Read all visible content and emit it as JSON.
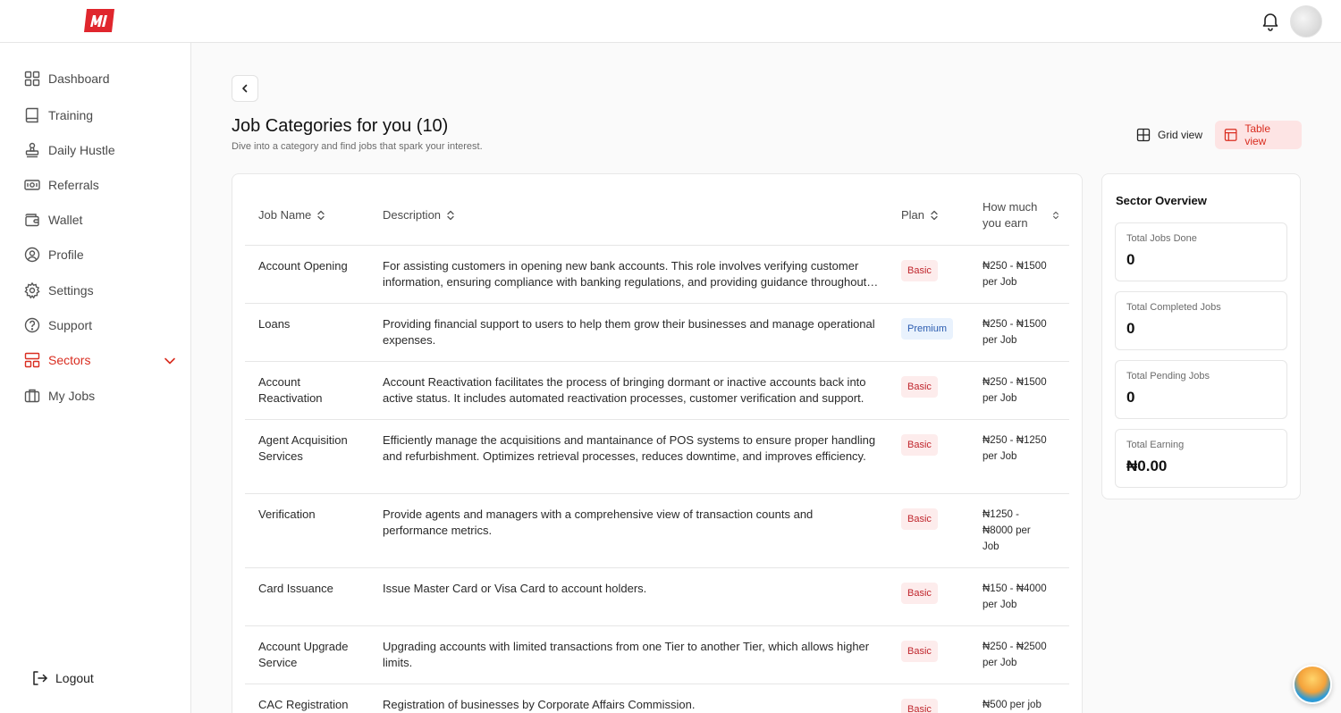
{
  "colors": {
    "accent": "#d92d20",
    "accent_bg": "#fde4e4"
  },
  "sidebar": {
    "items": [
      {
        "label": "Dashboard",
        "icon": "grid-icon"
      },
      {
        "label": "Training",
        "icon": "book-icon"
      },
      {
        "label": "Daily Hustle",
        "icon": "stamp-icon"
      },
      {
        "label": "Referrals",
        "icon": "cash-icon"
      },
      {
        "label": "Wallet",
        "icon": "wallet-icon"
      },
      {
        "label": "Profile",
        "icon": "user-circle-icon"
      },
      {
        "label": "Settings",
        "icon": "gear-icon"
      },
      {
        "label": "Support",
        "icon": "help-circle-icon"
      },
      {
        "label": "Sectors",
        "icon": "layout-icon",
        "active": true
      },
      {
        "label": "My Jobs",
        "icon": "briefcase-icon"
      }
    ],
    "logout_label": "Logout"
  },
  "main": {
    "title": "Job Categories for you (10)",
    "subtitle": "Dive into a category and find jobs that spark your interest.",
    "grid_view_label": "Grid view",
    "table_view_label": "Table view"
  },
  "table": {
    "headers": {
      "name": "Job Name",
      "description": "Description",
      "plan": "Plan",
      "earn": "How much you earn"
    },
    "rows": [
      {
        "name": "Account Opening",
        "description": "For assisting customers in opening new bank accounts. This role involves verifying customer information, ensuring compliance with banking regulations, and providing guidance throughout the process.",
        "plan": "Basic",
        "earn": "₦250 - ₦1500 per Job"
      },
      {
        "name": "Loans",
        "description": "Providing financial support to users to help them grow their businesses and manage operational expenses.",
        "plan": "Premium",
        "earn": "₦250 - ₦1500 per Job"
      },
      {
        "name": "Account Reactivation",
        "description": "Account Reactivation facilitates the process of bringing dormant or inactive accounts back into active status. It includes automated reactivation processes, customer verification and support.",
        "plan": "Basic",
        "earn": "₦250 - ₦1500 per Job"
      },
      {
        "name": "Agent Acquisition Services",
        "description": "Efficiently manage the acquisitions and mantainance of POS systems to ensure proper handling and refurbishment. Optimizes retrieval processes, reduces downtime, and improves efficiency.",
        "plan": "Basic",
        "earn": "₦250 - ₦1250 per Job"
      },
      {
        "name": "Verification",
        "description": "Provide agents and managers with a comprehensive view of transaction counts and performance metrics.",
        "plan": "Basic",
        "earn": "₦1250 - ₦8000 per Job"
      },
      {
        "name": "Card Issuance",
        "description": "Issue Master Card or Visa Card to account holders.",
        "plan": "Basic",
        "earn": "₦150 - ₦4000 per Job"
      },
      {
        "name": "Account Upgrade Service",
        "description": "Upgrading accounts with limited transactions from one Tier to another Tier, which allows higher limits.",
        "plan": "Basic",
        "earn": "₦250 - ₦2500 per Job"
      },
      {
        "name": "CAC Registration",
        "description": "Registration of businesses by Corporate Affairs Commission.",
        "plan": "Basic",
        "earn": "₦500 per job"
      }
    ]
  },
  "overview": {
    "title": "Sector Overview",
    "stats": [
      {
        "label": "Total Jobs Done",
        "value": "0"
      },
      {
        "label": "Total Completed Jobs",
        "value": "0"
      },
      {
        "label": "Total Pending Jobs",
        "value": "0"
      },
      {
        "label": "Total Earning",
        "value": "₦0.00"
      }
    ]
  }
}
